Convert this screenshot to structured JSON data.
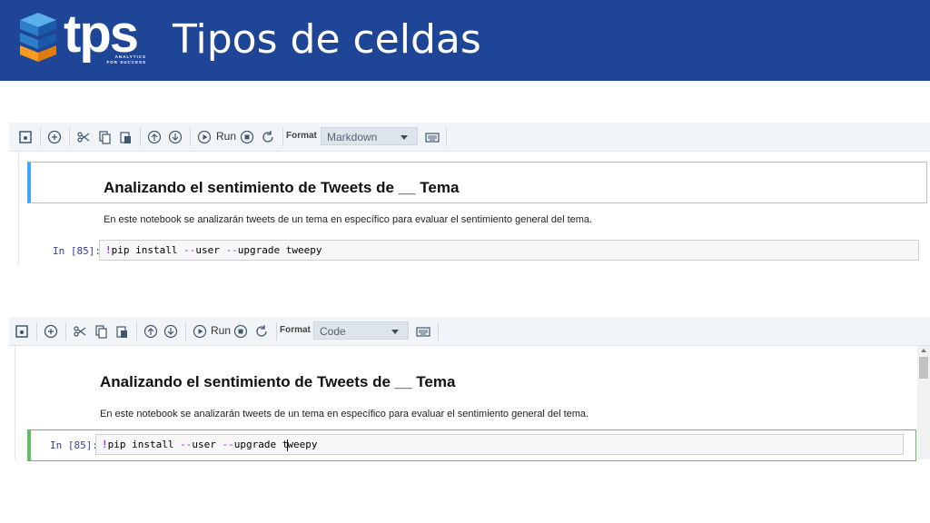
{
  "header": {
    "brand": "tps",
    "tagline_line1": "ANALYTICS",
    "tagline_line2": "FOR SUCCESS",
    "title": "Tipos de celdas",
    "background": "#1f4597"
  },
  "screens": [
    {
      "toolbar": {
        "run_label": "Run",
        "format_label": "Format",
        "cell_type": "Markdown",
        "icons": [
          "save-icon",
          "insert-cell-icon",
          "cut-icon",
          "copy-icon",
          "paste-icon",
          "move-up-icon",
          "move-down-icon",
          "run-icon",
          "stop-icon",
          "restart-icon",
          "keyboard-icon"
        ]
      },
      "markdown_cell": {
        "heading": "Analizando el sentimiento de Tweets de __ Tema",
        "paragraph": "En este notebook se analizarán tweets de un tema en específico para evaluar el sentimiento general del tema."
      },
      "code_cell": {
        "prompt": "In [85]:",
        "bang": "!",
        "cmd1": "pip install ",
        "flag1": "--",
        "cmd2": "user ",
        "flag2": "--",
        "cmd3": "upgrade tweepy"
      }
    },
    {
      "toolbar": {
        "run_label": "Run",
        "format_label": "Format",
        "cell_type": "Code"
      },
      "markdown_cell": {
        "heading": "Analizando el sentimiento de Tweets de __ Tema",
        "paragraph": "En este notebook se analizarán tweets de un tema en específico para evaluar el sentimiento general del tema."
      },
      "code_cell": {
        "prompt": "In [85]:",
        "bang": "!",
        "cmd1": "pip install ",
        "flag1": "--",
        "cmd2": "user ",
        "flag2": "--",
        "cmd3a": "upgrade t",
        "cmd3b": "weepy"
      }
    }
  ],
  "colors": {
    "markdown_selected_border": "#42a5f5",
    "code_selected_border": "#66bb6a",
    "prompt": "#303f9f"
  }
}
